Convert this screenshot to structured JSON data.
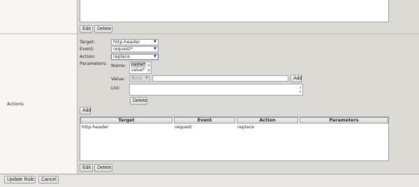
{
  "top_buttons": {
    "edit": "Edit",
    "delete": "Delete"
  },
  "actions_label": "Actions",
  "form": {
    "target_label": "Target:",
    "event_label": "Event:",
    "action_label": "Action:",
    "parameters_label": "Parameters:",
    "target_value": "http-header",
    "event_value": "request*",
    "action_value": "replace",
    "name_label": "Name:",
    "name_options": [
      "name*",
      "value*"
    ],
    "value_label": "Value:",
    "value_select": "None",
    "value_add": "Add",
    "list_label": "List:",
    "delete_button": "Delete",
    "add_button": "Add"
  },
  "table": {
    "headers": [
      "Target",
      "Event",
      "Action",
      "Parameters"
    ],
    "rows": [
      {
        "target": "http-header",
        "event": "request",
        "action": "replace",
        "parameters": ""
      }
    ]
  },
  "bottom_buttons": {
    "edit": "Edit",
    "delete": "Delete"
  },
  "footer": {
    "update": "Update Rule",
    "cancel": "Cancel"
  }
}
